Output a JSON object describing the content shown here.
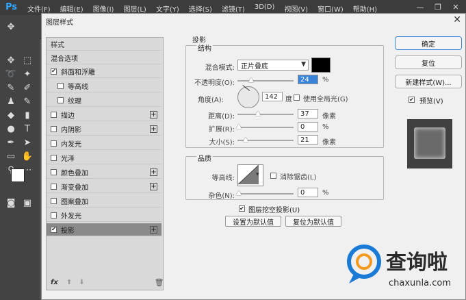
{
  "app": {
    "logo": "Ps",
    "menu": [
      "文件(F)",
      "编辑(E)",
      "图像(I)",
      "图层(L)",
      "文字(Y)",
      "选择(S)",
      "滤镜(T)",
      "3D(D)",
      "视图(V)",
      "窗口(W)",
      "帮助(H)"
    ]
  },
  "dialog": {
    "title": "图层样式",
    "left_panel": {
      "items": [
        {
          "label": "样式",
          "checkbox": false,
          "plus": false,
          "checked": false
        },
        {
          "label": "混合选项",
          "checkbox": false,
          "plus": false,
          "checked": false
        },
        {
          "label": "斜面和浮雕",
          "checkbox": true,
          "plus": false,
          "checked": true
        },
        {
          "label": "等高线",
          "checkbox": true,
          "plus": false,
          "checked": false,
          "indent": true
        },
        {
          "label": "纹理",
          "checkbox": true,
          "plus": false,
          "checked": false,
          "indent": true
        },
        {
          "label": "描边",
          "checkbox": true,
          "plus": true,
          "checked": false
        },
        {
          "label": "内阴影",
          "checkbox": true,
          "plus": true,
          "checked": false
        },
        {
          "label": "内发光",
          "checkbox": true,
          "plus": false,
          "checked": false
        },
        {
          "label": "光泽",
          "checkbox": true,
          "plus": false,
          "checked": false
        },
        {
          "label": "颜色叠加",
          "checkbox": true,
          "plus": true,
          "checked": false
        },
        {
          "label": "渐变叠加",
          "checkbox": true,
          "plus": true,
          "checked": false
        },
        {
          "label": "图案叠加",
          "checkbox": true,
          "plus": false,
          "checked": false
        },
        {
          "label": "外发光",
          "checkbox": true,
          "plus": false,
          "checked": false
        },
        {
          "label": "投影",
          "checkbox": true,
          "plus": true,
          "checked": true,
          "active": true
        }
      ],
      "footer_fx": "fx"
    },
    "drop_shadow": {
      "section_title": "投影",
      "structure_title": "结构",
      "blend_mode_label": "混合模式:",
      "blend_mode_value": "正片叠底",
      "shadow_color": "#000000",
      "opacity_label": "不透明度(O):",
      "opacity_value": "24",
      "opacity_unit": "%",
      "angle_label": "角度(A):",
      "angle_value": "142",
      "angle_unit": "度",
      "global_light_label": "使用全局光(G)",
      "distance_label": "距离(D):",
      "distance_value": "37",
      "distance_unit": "像素",
      "spread_label": "扩展(R):",
      "spread_value": "0",
      "spread_unit": "%",
      "size_label": "大小(S):",
      "size_value": "21",
      "size_unit": "像素",
      "quality_title": "品质",
      "contour_label": "等高线:",
      "antialias_label": "消除锯齿(L)",
      "noise_label": "杂色(N):",
      "noise_value": "0",
      "noise_unit": "%",
      "knockout_label": "图层挖空投影(U)",
      "set_default_button": "设置为默认值",
      "reset_default_button": "复位为默认值"
    },
    "right_buttons": {
      "ok": "确定",
      "reset": "复位",
      "new_style": "新建样式(W)...",
      "preview_label": "预览(V)"
    }
  },
  "watermark": {
    "brand": "查询啦",
    "url": "chaxunla.com"
  }
}
